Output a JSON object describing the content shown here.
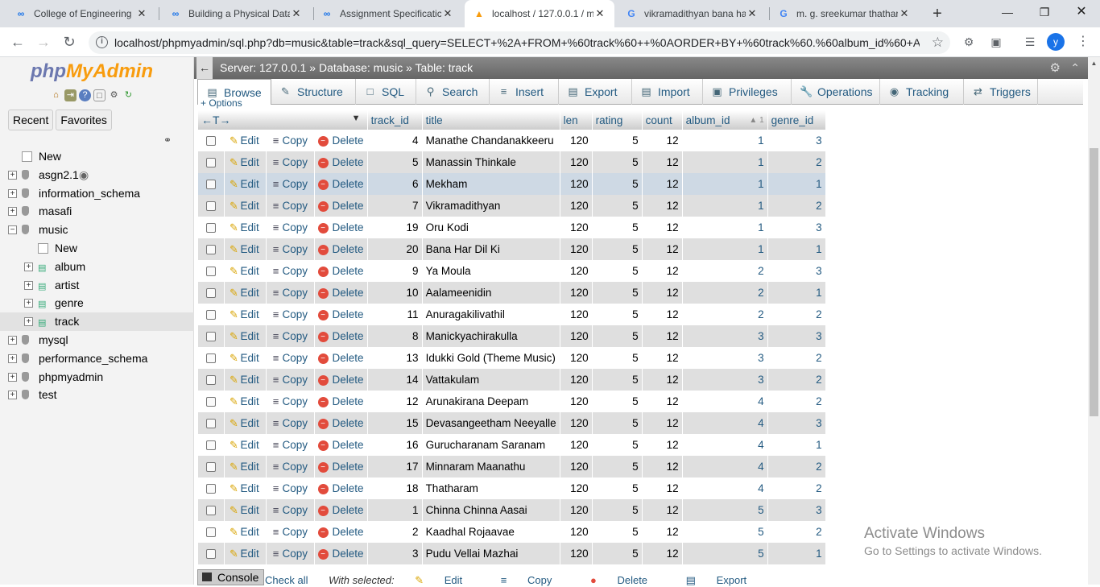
{
  "browser": {
    "tabs": [
      {
        "title": "College of Engineering",
        "icon": "link-icon",
        "active": false
      },
      {
        "title": "Building a Physical Data",
        "icon": "link-icon",
        "active": false
      },
      {
        "title": "Assignment Specificatic",
        "icon": "link-icon",
        "active": false
      },
      {
        "title": "localhost / 127.0.0.1 / m",
        "icon": "phpmyadmin-icon",
        "active": true
      },
      {
        "title": "vikramadithyan bana ha",
        "icon": "google-icon",
        "active": false
      },
      {
        "title": "m. g. sreekumar thathar",
        "icon": "google-icon",
        "active": false
      }
    ],
    "url": "localhost/phpmyadmin/sql.php?db=music&table=track&sql_query=SELECT+%2A+FROM+%60track%60++%0AORDER+BY+%60track%60.%60album_id%60+A...",
    "avatar_letter": "y"
  },
  "sidebar": {
    "logo_php": "php",
    "logo_myadmin": "MyAdmin",
    "tabs": [
      "Recent",
      "Favorites"
    ],
    "tree": [
      {
        "label": "New",
        "level": 0,
        "type": "new"
      },
      {
        "label": "asgn2.1",
        "level": 0,
        "type": "db",
        "eye": true
      },
      {
        "label": "information_schema",
        "level": 0,
        "type": "db"
      },
      {
        "label": "masafi",
        "level": 0,
        "type": "db"
      },
      {
        "label": "music",
        "level": 0,
        "type": "db-open"
      },
      {
        "label": "New",
        "level": 1,
        "type": "new"
      },
      {
        "label": "album",
        "level": 1,
        "type": "table"
      },
      {
        "label": "artist",
        "level": 1,
        "type": "table"
      },
      {
        "label": "genre",
        "level": 1,
        "type": "table"
      },
      {
        "label": "track",
        "level": 1,
        "type": "table",
        "selected": true
      },
      {
        "label": "mysql",
        "level": 0,
        "type": "db"
      },
      {
        "label": "performance_schema",
        "level": 0,
        "type": "db"
      },
      {
        "label": "phpmyadmin",
        "level": 0,
        "type": "db"
      },
      {
        "label": "test",
        "level": 0,
        "type": "db"
      }
    ]
  },
  "breadcrumb": "Server: 127.0.0.1 » Database: music » Table: track",
  "menu": [
    {
      "label": "Browse",
      "icon": "browse-icon",
      "active": true
    },
    {
      "label": "Structure",
      "icon": "structure-icon"
    },
    {
      "label": "SQL",
      "icon": "sql-icon"
    },
    {
      "label": "Search",
      "icon": "search-icon"
    },
    {
      "label": "Insert",
      "icon": "insert-icon"
    },
    {
      "label": "Export",
      "icon": "export-icon"
    },
    {
      "label": "Import",
      "icon": "import-icon"
    },
    {
      "label": "Privileges",
      "icon": "privileges-icon"
    },
    {
      "label": "Operations",
      "icon": "operations-icon"
    },
    {
      "label": "Tracking",
      "icon": "tracking-icon"
    },
    {
      "label": "Triggers",
      "icon": "triggers-icon"
    }
  ],
  "options_label": "+ Options",
  "table": {
    "col_arrows": "←T→",
    "columns": [
      "track_id",
      "title",
      "len",
      "rating",
      "count",
      "album_id",
      "genre_id"
    ],
    "sort_column": "album_id",
    "sort_indicator": "▲ 1",
    "actions": {
      "edit": "Edit",
      "copy": "Copy",
      "delete": "Delete"
    },
    "rows": [
      [
        "4",
        "Manathe Chandanakkeeru",
        "120",
        "5",
        "12",
        "1",
        "3"
      ],
      [
        "5",
        "Manassin Thinkale",
        "120",
        "5",
        "12",
        "1",
        "2"
      ],
      [
        "6",
        "Mekham",
        "120",
        "5",
        "12",
        "1",
        "1"
      ],
      [
        "7",
        "Vikramadithyan",
        "120",
        "5",
        "12",
        "1",
        "2"
      ],
      [
        "19",
        "Oru Kodi",
        "120",
        "5",
        "12",
        "1",
        "3"
      ],
      [
        "20",
        "Bana Har Dil Ki",
        "120",
        "5",
        "12",
        "1",
        "1"
      ],
      [
        "9",
        "Ya Moula",
        "120",
        "5",
        "12",
        "2",
        "3"
      ],
      [
        "10",
        "Aalameenidin",
        "120",
        "5",
        "12",
        "2",
        "1"
      ],
      [
        "11",
        "Anuragakilivathil",
        "120",
        "5",
        "12",
        "2",
        "2"
      ],
      [
        "8",
        "Manickyachirakulla",
        "120",
        "5",
        "12",
        "3",
        "3"
      ],
      [
        "13",
        "Idukki Gold (Theme Music)",
        "120",
        "5",
        "12",
        "3",
        "2"
      ],
      [
        "14",
        "Vattakulam",
        "120",
        "5",
        "12",
        "3",
        "2"
      ],
      [
        "12",
        "Arunakirana Deepam",
        "120",
        "5",
        "12",
        "4",
        "2"
      ],
      [
        "15",
        "Devasangeetham Neeyalle",
        "120",
        "5",
        "12",
        "4",
        "3"
      ],
      [
        "16",
        "Gurucharanam Saranam",
        "120",
        "5",
        "12",
        "4",
        "1"
      ],
      [
        "17",
        "Minnaram Maanathu",
        "120",
        "5",
        "12",
        "4",
        "2"
      ],
      [
        "18",
        "Thatharam",
        "120",
        "5",
        "12",
        "4",
        "2"
      ],
      [
        "1",
        "Chinna Chinna Aasai",
        "120",
        "5",
        "12",
        "5",
        "3"
      ],
      [
        "2",
        "Kaadhal Rojaavae",
        "120",
        "5",
        "12",
        "5",
        "2"
      ],
      [
        "3",
        "Pudu Vellai Mazhai",
        "120",
        "5",
        "12",
        "5",
        "1"
      ]
    ],
    "highlighted_row": 2
  },
  "footer": {
    "console": "Console",
    "check_all": "Check all",
    "with_selected": "With selected:",
    "edit": "Edit",
    "copy": "Copy",
    "delete": "Delete",
    "export": "Export"
  },
  "watermark": {
    "line1": "Activate Windows",
    "line2": "Go to Settings to activate Windows."
  }
}
